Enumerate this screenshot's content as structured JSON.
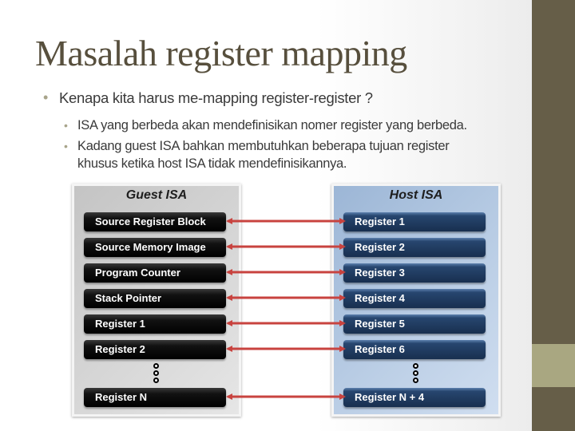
{
  "slide": {
    "title": "Masalah register mapping",
    "bullets": [
      {
        "text": "Kenapa kita harus me-mapping register-register ?",
        "sub": [
          "ISA yang berbeda akan mendefinisikan nomer register yang berbeda.",
          "Kadang guest ISA bahkan membutuhkan beberapa tujuan register",
          "khusus ketika host ISA tidak mendefinisikannya."
        ]
      }
    ]
  },
  "diagram": {
    "guest": {
      "title": "Guest ISA",
      "registers": [
        "Source Register Block",
        "Source Memory Image",
        "Program Counter",
        "Stack Pointer",
        "Register  1",
        "Register  2",
        "Register  N"
      ]
    },
    "host": {
      "title": "Host ISA",
      "registers": [
        "Register  1",
        "Register  2",
        "Register  3",
        "Register  4",
        "Register  5",
        "Register  6",
        "Register  N + 4"
      ]
    },
    "arrow_color": "#c8433f",
    "mapping": "bidirectional one-to-one"
  },
  "theme": {
    "sidebar_color": "#665e48",
    "sidebar_band_color": "#a9a781",
    "title_color": "#574f3d"
  }
}
